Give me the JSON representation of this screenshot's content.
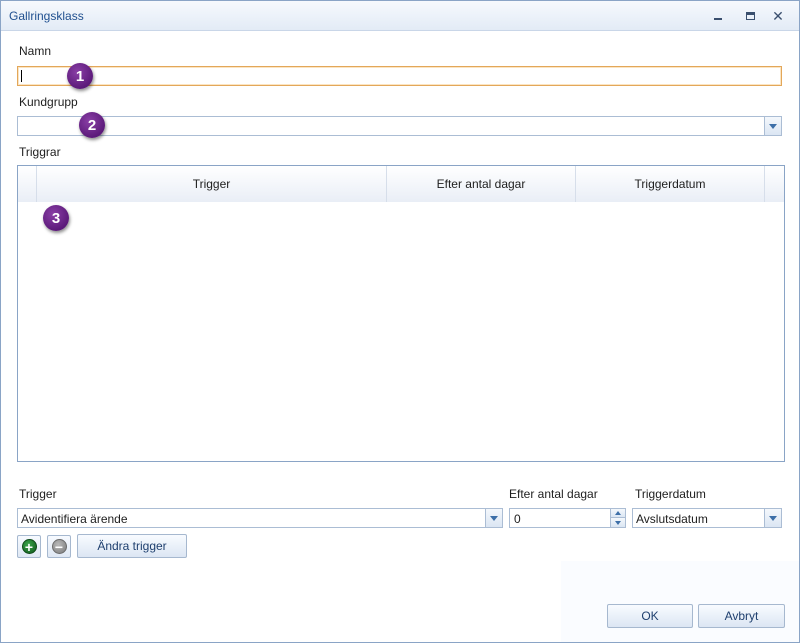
{
  "window": {
    "title": "Gallringsklass",
    "minimize_label": "",
    "maximize_label": "",
    "close_label": "✕"
  },
  "form": {
    "name_label": "Namn",
    "name_value": "",
    "kundgrupp_label": "Kundgrupp",
    "kundgrupp_value": "",
    "triggrar_label": "Triggrar"
  },
  "grid": {
    "columns": [
      "Trigger",
      "Efter antal dagar",
      "Triggerdatum"
    ],
    "rows": []
  },
  "editor": {
    "trigger_label": "Trigger",
    "trigger_value": "Avidentifiera ärende",
    "days_label": "Efter antal dagar",
    "days_value": "0",
    "date_label": "Triggerdatum",
    "date_value": "Avslutsdatum",
    "change_button": "Ändra trigger"
  },
  "footer": {
    "ok_button": "OK",
    "cancel_button": "Avbryt"
  },
  "callouts": [
    "1",
    "2",
    "3"
  ],
  "icons": {
    "add": "plus-circle-icon",
    "remove": "minus-circle-icon",
    "dropdown": "chevron-down-icon"
  },
  "colors": {
    "accent_title": "#1f4f8f",
    "focus_border": "#e3a75a",
    "callout": "#6a2489",
    "add_green": "#2e8b3d"
  }
}
